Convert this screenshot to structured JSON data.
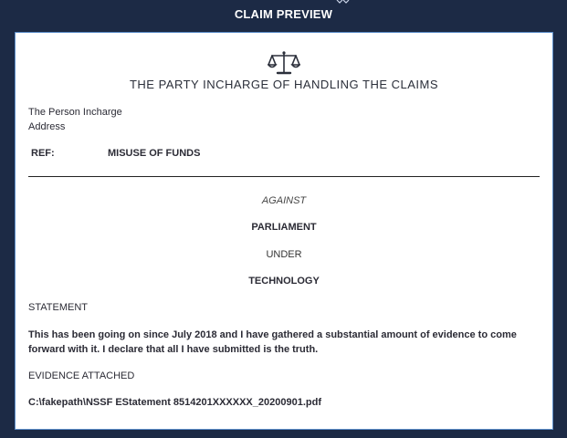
{
  "header": {
    "title": "CLAIM PREVIEW"
  },
  "document": {
    "title": "THE PARTY INCHARGE OF HANDLING THE CLAIMS",
    "recipient_name": "The Person Incharge",
    "recipient_address": "Address",
    "ref_label": "REF:",
    "ref_value": "MISUSE OF FUNDS",
    "against_label": "AGAINST",
    "against_value": "PARLIAMENT",
    "under_label": "UNDER",
    "under_value": "TECHNOLOGY",
    "statement_label": "STATEMENT",
    "statement_text": "This has been going on since July 2018 and I have gathered a substantial amount of evidence to come forward with it. I declare that all I have submitted is the truth.",
    "evidence_label": "EVIDENCE ATTACHED",
    "evidence_file": "C:\\fakepath\\NSSF EStatement 8514201XXXXXX_20200901.pdf"
  },
  "colors": {
    "background": "#1c2a45",
    "paper_border": "#5b8dc9",
    "text": "#2b2b35"
  },
  "icons": {
    "logo": "scale-of-justice-icon",
    "top_notch": "chevron-icon"
  }
}
